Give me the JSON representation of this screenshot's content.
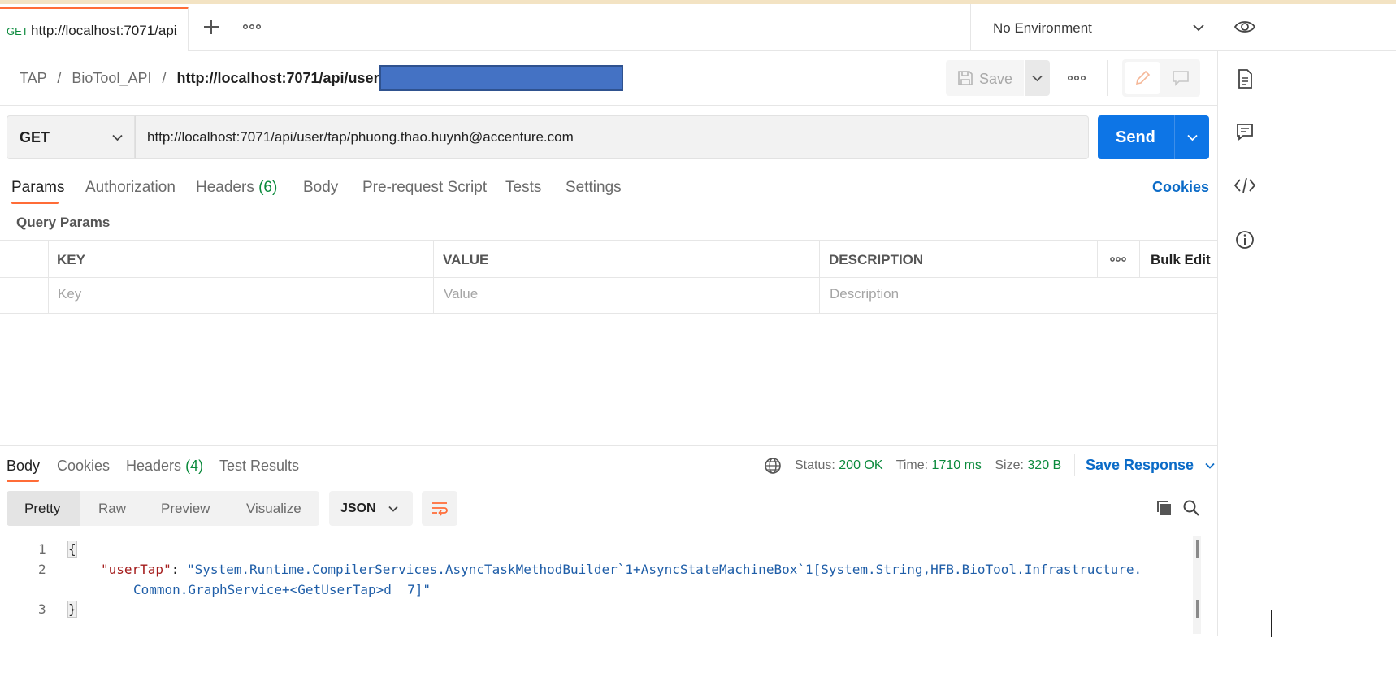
{
  "tab_bar": {
    "active_tab": {
      "method": "GET",
      "label": "http://localhost:7071/api/"
    },
    "new_tab_icon": "plus-icon",
    "more_icon": "ellipsis-icon",
    "environment": "No Environment"
  },
  "breadcrumb": {
    "items": [
      "TAP",
      "BioTool_API"
    ],
    "separator": "/",
    "current": "http://localhost:7071/api/user/tap/"
  },
  "toolbar": {
    "save_label": "Save"
  },
  "request": {
    "method": "GET",
    "url": "http://localhost:7071/api/user/tap/phuong.thao.huynh@accenture.com",
    "send_label": "Send"
  },
  "request_tabs": {
    "params": "Params",
    "authorization": "Authorization",
    "headers": "Headers",
    "headers_count": "(6)",
    "body": "Body",
    "pre_request": "Pre-request Script",
    "tests": "Tests",
    "settings": "Settings",
    "cookies": "Cookies"
  },
  "query_params": {
    "title": "Query Params",
    "columns": {
      "key": "KEY",
      "value": "VALUE",
      "description": "DESCRIPTION",
      "bulk_edit": "Bulk Edit"
    },
    "placeholders": {
      "key": "Key",
      "value": "Value",
      "description": "Description"
    }
  },
  "response_tabs": {
    "body": "Body",
    "cookies": "Cookies",
    "headers": "Headers",
    "headers_count": "(4)",
    "test_results": "Test Results"
  },
  "response_status": {
    "status_label": "Status:",
    "status_value": "200 OK",
    "time_label": "Time:",
    "time_value": "1710 ms",
    "size_label": "Size:",
    "size_value": "320 B",
    "save_response": "Save Response"
  },
  "response_view": {
    "modes": [
      "Pretty",
      "Raw",
      "Preview",
      "Visualize"
    ],
    "active_mode": "Pretty",
    "format": "JSON"
  },
  "response_body": {
    "line_numbers": [
      "1",
      "2",
      "3"
    ],
    "open_brace": "{",
    "close_brace": "}",
    "key": "\"userTap\"",
    "colon": ":",
    "value_line1": "\"System.Runtime.CompilerServices.AsyncTaskMethodBuilder`1+AsyncStateMachineBox`1[System.String,HFB.BioTool.Infrastructure.",
    "value_line2": "Common.GraphService+<GetUserTap>d__7]\""
  },
  "colors": {
    "accent": "#ff6c37",
    "send_button": "#0d75e6",
    "link": "#0b6bc7",
    "status_ok": "#0b8a3c",
    "json_key": "#a41c1c",
    "json_string": "#1f5ea8",
    "redaction": "#4472c4"
  }
}
